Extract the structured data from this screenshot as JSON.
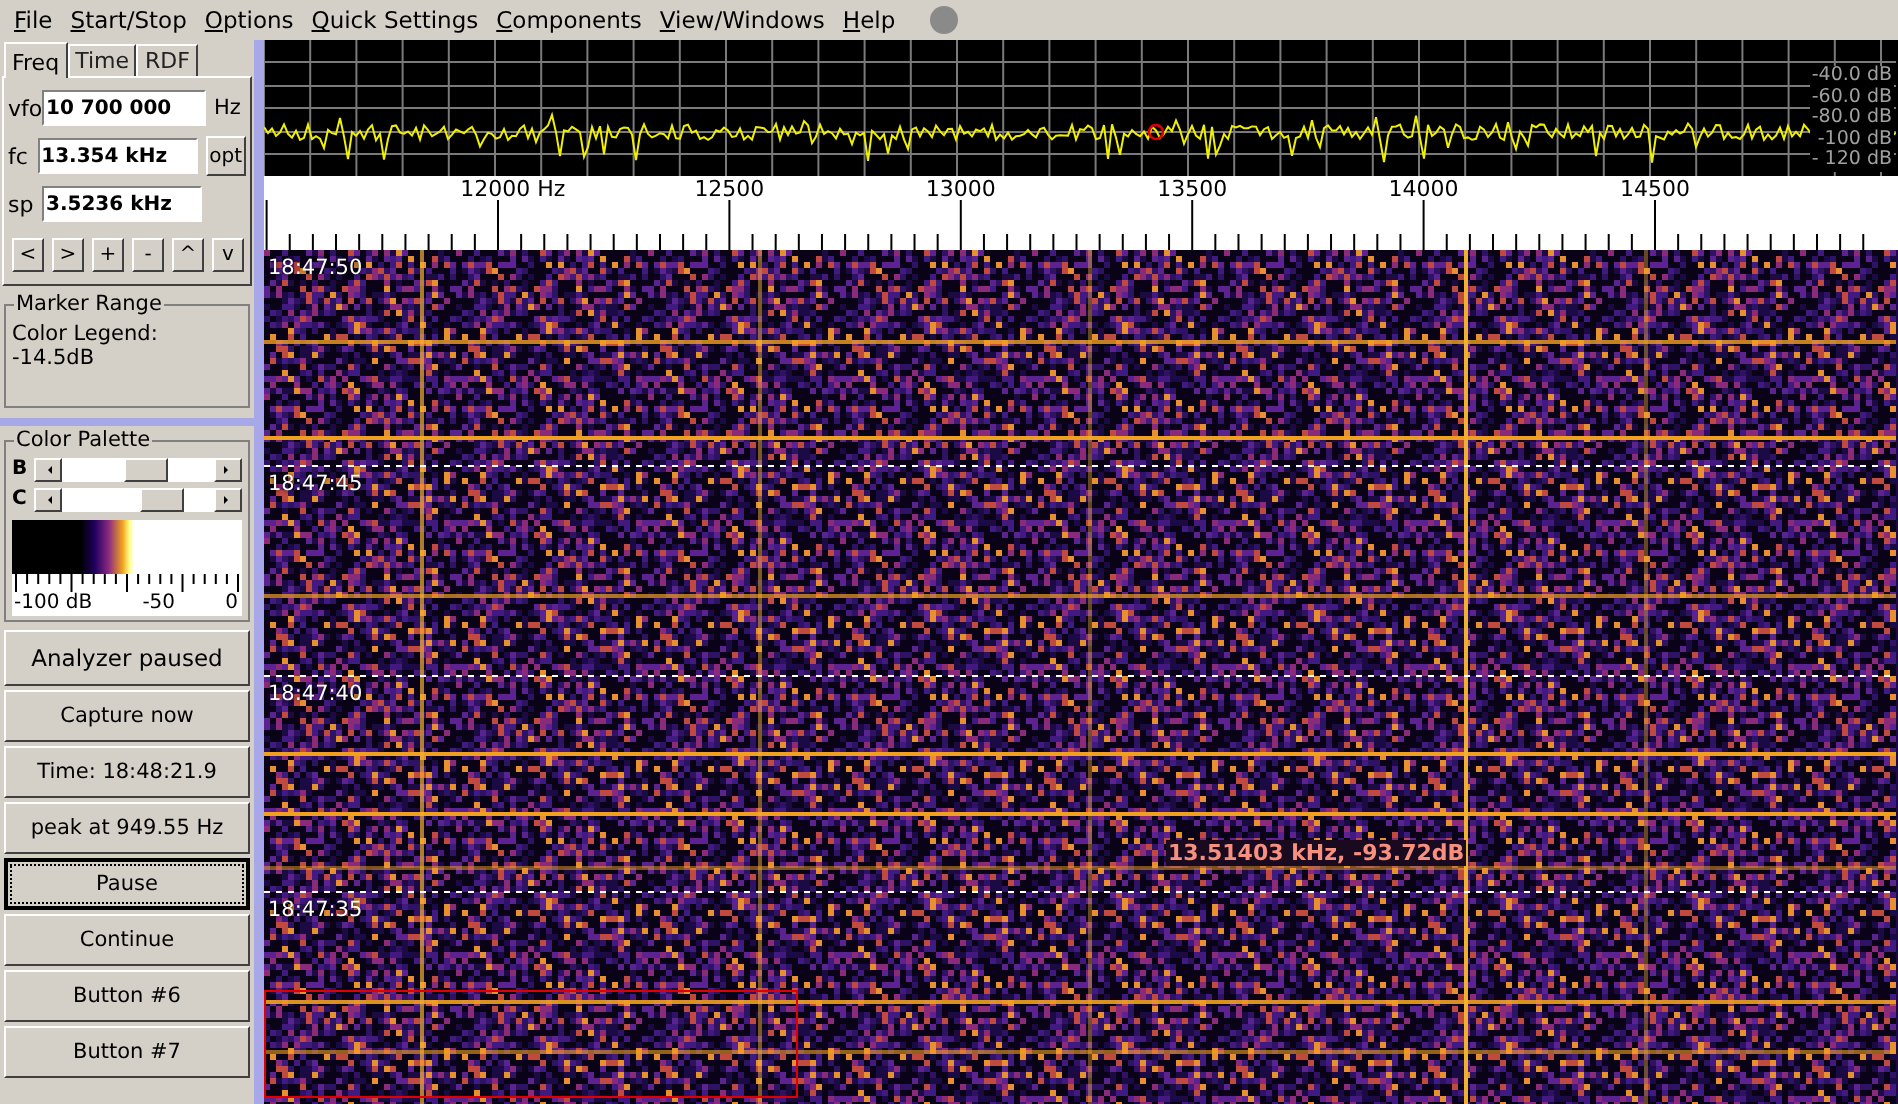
{
  "menu": [
    "File",
    "Start/Stop",
    "Options",
    "Quick Settings",
    "Components",
    "View/Windows",
    "Help"
  ],
  "tabs": [
    {
      "label": "Freq",
      "selected": true
    },
    {
      "label": "Time",
      "selected": false
    },
    {
      "label": "RDF",
      "selected": false
    }
  ],
  "fields": [
    {
      "label": "vfo",
      "value": "10 700 000",
      "unit": "Hz"
    },
    {
      "label": "fc",
      "value": "13.354 kHz",
      "button": "opt"
    },
    {
      "label": "sp",
      "value": "3.5236 kHz"
    }
  ],
  "nav_buttons": [
    "<",
    ">",
    "+",
    "-",
    "^",
    "v"
  ],
  "marker_range": {
    "title": "Marker Range",
    "lines": [
      "Color Legend:",
      "-14.5dB"
    ]
  },
  "color_palette": {
    "title": "Color Palette",
    "sliders": [
      {
        "label": "B",
        "level": 0.55
      },
      {
        "label": "C",
        "level": 0.66
      }
    ],
    "scale_labels": [
      "-100 dB",
      "-50",
      "0"
    ]
  },
  "buttons": [
    {
      "label": "Analyzer paused",
      "focused": false
    },
    {
      "label": "Capture now",
      "focused": false
    },
    {
      "label": "Time:  18:48:21.9",
      "focused": false
    },
    {
      "label": "peak at 949.55 Hz",
      "focused": false
    },
    {
      "label": "Pause",
      "focused": true
    },
    {
      "label": "Continue",
      "focused": false
    },
    {
      "label": "Button #6",
      "focused": false
    },
    {
      "label": "Button #7",
      "focused": false
    }
  ],
  "spectrum": {
    "db_labels": [
      "-40.0 dB",
      "-60.0 dB",
      "-80.0 dB",
      "-100 dB",
      "- 120 dB"
    ]
  },
  "frequency_axis": {
    "labels": [
      "12000 Hz",
      "12500",
      "13000",
      "13500",
      "14000",
      "14500"
    ]
  },
  "waterfall": {
    "timestamps": [
      "18:47:50",
      "18:47:45",
      "18:47:40",
      "18:47:35"
    ],
    "marker_readout": "13.51403 kHz, -93.72dB"
  }
}
